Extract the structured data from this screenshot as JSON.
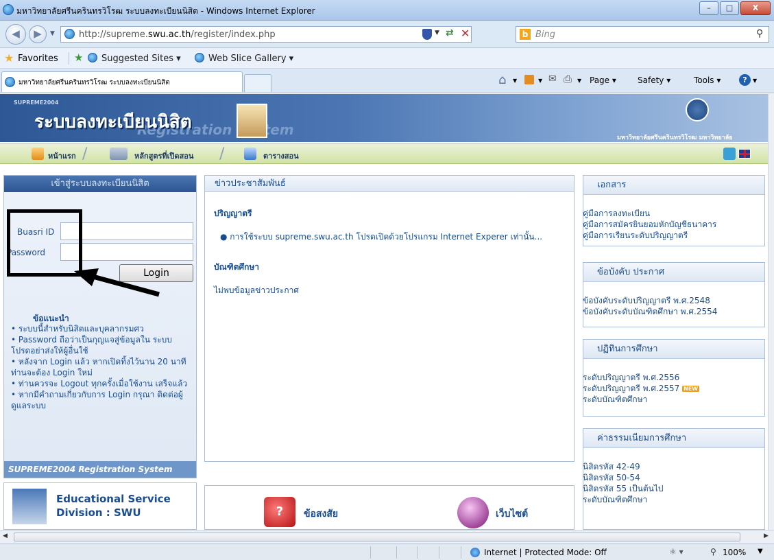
{
  "window": {
    "title": "มหาวิทยาลัยศรีนครินทรวิโรฒ ระบบลงทะเบียนนิสิต - Windows Internet Explorer",
    "minimize": "–",
    "maximize": "□",
    "close": "X"
  },
  "address": {
    "url_prefix": "http://supreme.",
    "url_domain": "swu.ac.th",
    "url_suffix": "/register/index.php",
    "search_engine": "Bing"
  },
  "favorites": {
    "favorites_label": "Favorites",
    "suggested_sites": "Suggested Sites ▾",
    "web_slice": "Web Slice Gallery ▾"
  },
  "tab": {
    "title": "มหาวิทยาลัยศรีนครินทรวิโรฒ ระบบลงทะเบียนนิสิต"
  },
  "commandbar": {
    "page": "Page ▾",
    "safety": "Safety ▾",
    "tools": "Tools ▾"
  },
  "banner": {
    "small": "SUPREME2004",
    "title": "ระบบลงทะเบียนนิสิต",
    "subtitle": "Registration System",
    "university": "มหาวิทยาลัยศรีนครินทรวิโรฒ  มหาวิทยาลัย"
  },
  "menu": {
    "home": "หน้าแรก",
    "courses": "หลักสูตรที่เปิดสอน",
    "schedule": "ตารางสอน"
  },
  "login": {
    "header": "เข้าสู่ระบบลงทะเบียนนิสิต",
    "id_label": "Buasri ID",
    "password_label": "Password",
    "button": "Login",
    "footer": "SUPREME2004  Registration System"
  },
  "advice": {
    "title": "ข้อแนะนำ",
    "items": [
      "ระบบนี้สำหรับนิสิตและบุคลากรมศว",
      "Password ถือว่าเป็นกุญแจสู่ข้อมูลใน ระบบ โปรดอย่าส่งให้ผู้อื่นใช้",
      "หลังจาก Login แล้ว หากเปิดทิ้งไว้นาน 20 นาที ท่านจะต้อง Login ใหม่",
      "ท่านควรจะ Logout ทุกครั้งเมื่อใช้งาน เสร็จแล้ว",
      "หากมีคำถามเกี่ยวกับการ Login กรุณา ติดต่อผู้ดูแลระบบ"
    ]
  },
  "news": {
    "header": "ข่าวประชาสัมพันธ์",
    "section1": "ปริญญาตรี",
    "item1": "การใช้ระบบ supreme.swu.ac.th โปรดเปิดด้วยโปรแกรม Internet Experer เท่านั้น...",
    "section2": "บัณฑิตศึกษา",
    "none": "ไม่พบข้อมูลข่าวประกาศ"
  },
  "bottom_links": {
    "faq": "ข้อสงสัย",
    "website": "เว็บไซต์"
  },
  "edu": {
    "line1": "Educational Service",
    "line2": "Division : SWU"
  },
  "docs": {
    "header": "เอกสาร",
    "links": [
      "คู่มือการลงทะเบียน",
      "คู่มือการสมัครยินยอมหักบัญชีธนาคาร",
      "คู่มือการเรียนระดับปริญญาตรี"
    ]
  },
  "rules": {
    "header": "ข้อบังคับ ประกาศ",
    "links": [
      "ข้อบังคับระดับปริญญาตรี พ.ศ.2548",
      "ข้อบังคับระดับบัณฑิตศึกษา พ.ศ.2554"
    ]
  },
  "calendar": {
    "header": "ปฏิทินการศึกษา",
    "links": [
      "ระดับปริญญาตรี พ.ศ.2556",
      "ระดับปริญญาตรี พ.ศ.2557",
      "ระดับบัณฑิตศึกษา"
    ],
    "new_badge": "NEW"
  },
  "fees": {
    "header": "ค่าธรรมเนียมการศึกษา",
    "links": [
      "นิสิตรหัส 42-49",
      "นิสิตรหัส 50-54",
      "นิสิตรหัส 55 เป็นต้นไป",
      "ระดับบัณฑิตศึกษา"
    ]
  },
  "status": {
    "zone": "Internet | Protected Mode: Off",
    "zoom": "100%"
  }
}
